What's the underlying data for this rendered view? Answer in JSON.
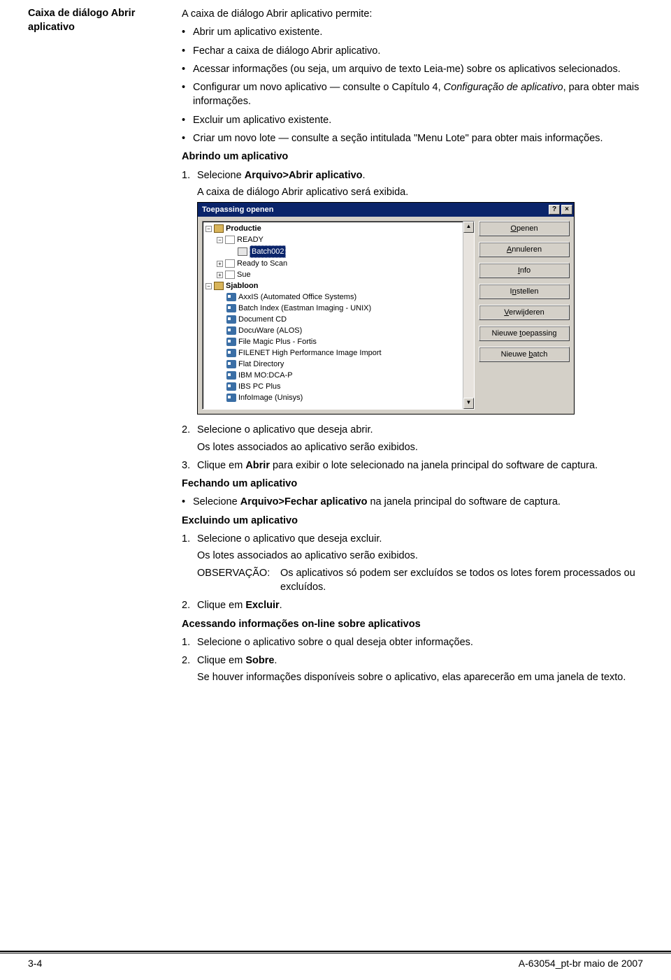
{
  "left_heading": "Caixa de diálogo Abrir aplicativo",
  "intro": "A caixa de diálogo Abrir aplicativo permite:",
  "bullets": [
    "Abrir um aplicativo existente.",
    "Fechar a caixa de diálogo Abrir aplicativo.",
    "Acessar informações (ou seja, um arquivo de texto Leia-me) sobre os aplicativos selecionados.",
    "Configurar um novo aplicativo — consulte o Capítulo 4, <i>Configuração de aplicativo</i>, para obter mais informações.",
    "Excluir um aplicativo existente.",
    "Criar um novo lote — consulte a seção intitulada \"Menu Lote\" para obter mais informações."
  ],
  "h_abrindo": "Abrindo um aplicativo",
  "step1_prefix": "Selecione ",
  "step1_bold": "Arquivo>Abrir aplicativo",
  "step1_suffix": ".",
  "step1_sub": "A caixa de diálogo Abrir aplicativo será exibida.",
  "dialog": {
    "title": "Toepassing openen",
    "buttons": [
      "Openen",
      "Annuleren",
      "Info",
      "Instellen",
      "Verwijderen",
      "Nieuwe toepassing",
      "Nieuwe batch"
    ],
    "button_underline_idx": [
      0,
      0,
      0,
      1,
      0,
      7,
      7
    ],
    "tree": {
      "root1": "Productie",
      "ready": "READY",
      "batch": "Batch002",
      "ready2": "Ready to Scan",
      "sue": "Sue",
      "root2": "Sjabloon",
      "items": [
        "AxxIS (Automated Office Systems)",
        "Batch Index (Eastman Imaging - UNIX)",
        "Document CD",
        "DocuWare (ALOS)",
        "File Magic Plus - Fortis",
        "FILENET High Performance Image Import",
        "Flat Directory",
        "IBM MO:DCA-P",
        "IBS PC Plus",
        "InfoImage (Unisys)"
      ]
    }
  },
  "step2": "Selecione o aplicativo que deseja abrir.",
  "step2_sub": "Os lotes associados ao aplicativo serão exibidos.",
  "step3_prefix": "Clique em ",
  "step3_bold": "Abrir",
  "step3_suffix": " para exibir o lote selecionado na janela principal do software de captura.",
  "h_fechando": "Fechando um aplicativo",
  "fech_bullet_prefix": "Selecione ",
  "fech_bullet_bold": "Arquivo>Fechar aplicativo",
  "fech_bullet_suffix": " na janela principal do software de captura.",
  "h_excluindo": "Excluindo um aplicativo",
  "ex_step1": "Selecione o aplicativo que deseja excluir.",
  "ex_step1_sub": "Os lotes associados ao aplicativo serão exibidos.",
  "note_label": "OBSERVAÇÃO:",
  "note_text": "Os aplicativos só podem ser excluídos se todos os lotes forem processados ou excluídos.",
  "ex_step2_prefix": "Clique em ",
  "ex_step2_bold": "Excluir",
  "ex_step2_suffix": ".",
  "h_acessando": "Acessando informações on-line sobre aplicativos",
  "ac_step1": "Selecione o aplicativo sobre o qual deseja obter informações.",
  "ac_step2_prefix": "Clique em ",
  "ac_step2_bold": "Sobre",
  "ac_step2_suffix": ".",
  "ac_step2_sub": "Se houver informações disponíveis sobre o aplicativo, elas aparecerão em uma janela de texto.",
  "footer_left": "3-4",
  "footer_right": "A-63054_pt-br  maio de 2007"
}
